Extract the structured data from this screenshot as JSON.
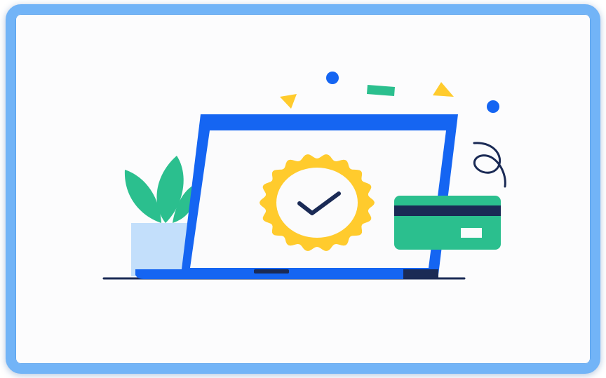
{
  "illustration": {
    "icons": {
      "plant": "plant-icon",
      "laptop": "laptop-icon",
      "badge": "verified-badge-icon",
      "check": "checkmark-icon",
      "card": "credit-card-icon",
      "swirl": "swirl-icon",
      "confetti": "confetti-icon"
    },
    "colors": {
      "frame_border": "#72b4f7",
      "background": "#fcfcfd",
      "laptop_blue": "#1565f2",
      "navy": "#1a2a55",
      "badge_yellow": "#ffcb2d",
      "green": "#2bbf8e",
      "pot_blue": "#c3dffb",
      "confetti_blue": "#1565f2",
      "confetti_yellow": "#ffcb2d",
      "confetti_green": "#2bbf8e"
    }
  }
}
